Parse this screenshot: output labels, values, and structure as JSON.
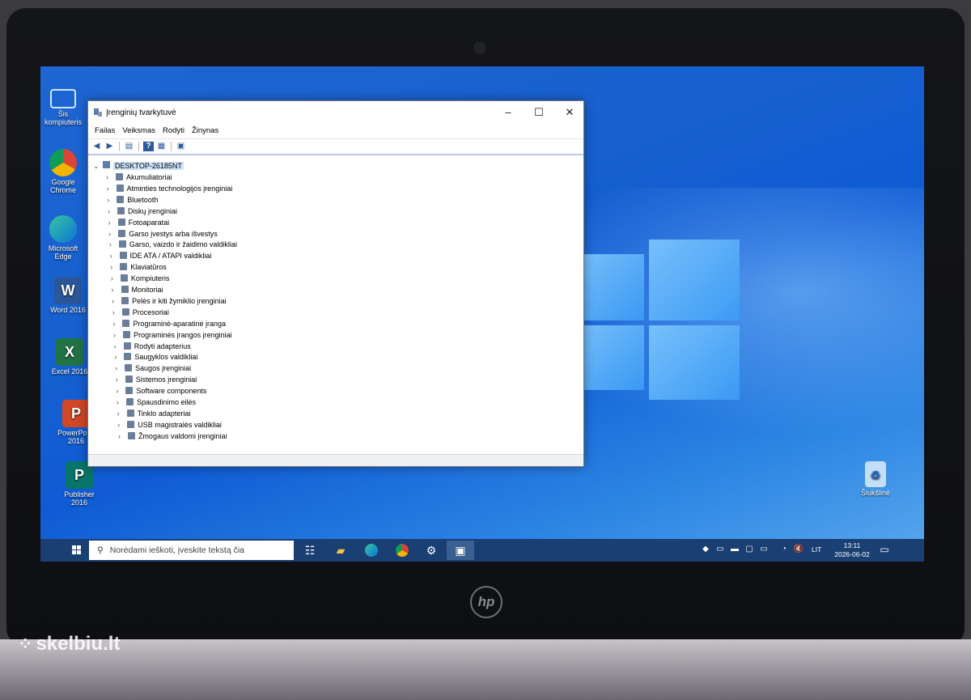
{
  "watermark": {
    "text": "skelbiu.lt"
  },
  "laptop": {
    "brand": "hp"
  },
  "desktop_icons": [
    {
      "label": "Šis kompiuteris"
    },
    {
      "label": "Google Chrome"
    },
    {
      "label": "Microsoft Edge"
    },
    {
      "label": "Word 2016"
    },
    {
      "label": "Excel 2016"
    },
    {
      "label": "PowerPoint 2016"
    },
    {
      "label": "Publisher 2016"
    },
    {
      "label": "Šiukšlinė"
    }
  ],
  "window": {
    "title": "Įrenginių tvarkytuvė",
    "controls": {
      "minimize": "–",
      "maximize": "☐",
      "close": "✕"
    },
    "menu": [
      "Failas",
      "Veiksmas",
      "Rodyti",
      "Žinynas"
    ],
    "tree": {
      "root": "DESKTOP-26185NT",
      "items": [
        "Akumuliatoriai",
        "Atminties technologijos įrenginiai",
        "Bluetooth",
        "Diskų įrenginiai",
        "Fotoaparatai",
        "Garso įvestys arba išvestys",
        "Garso, vaizdo ir žaidimo valdikliai",
        "IDE ATA / ATAPI valdikliai",
        "Klaviatūros",
        "Kompiuteris",
        "Monitoriai",
        "Pelės ir kiti žymiklio įrenginiai",
        "Procesoriai",
        "Programinė-aparatinė įranga",
        "Programinės įrangos įrenginiai",
        "Rodyti adapterius",
        "Saugyklos valdikliai",
        "Saugos įrenginiai",
        "Sistemos įrenginiai",
        "Software components",
        "Spausdinimo eilės",
        "Tinklo adapteriai",
        "USB magistralės valdikliai",
        "Žmogaus valdomi įrenginiai"
      ]
    }
  },
  "taskbar": {
    "search_placeholder": "Norėdami ieškoti, įveskite tekstą čia",
    "language": "LIT",
    "time": "13:11",
    "date": "2026-06-02"
  },
  "colors": {
    "taskbar": "#1a3f73",
    "desktop_blue": "#1660cf",
    "selection": "#cde3fa"
  }
}
